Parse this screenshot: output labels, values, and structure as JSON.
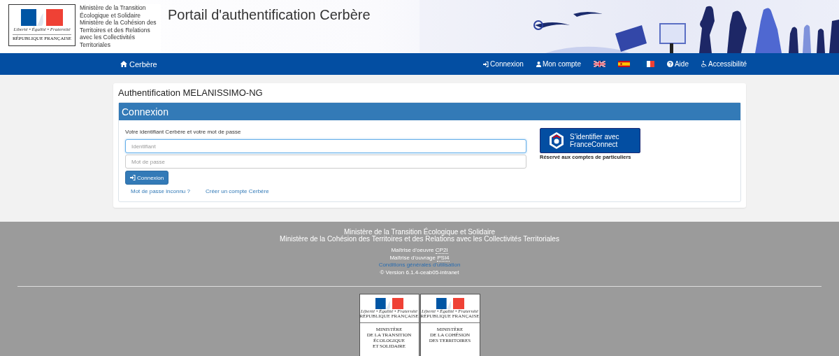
{
  "header": {
    "logo": {
      "motto": "Liberté • Égalité • Fraternité",
      "republic": "RÉPUBLIQUE FRANÇAISE"
    },
    "ministry_lines": [
      "Ministère de la Transition",
      "Écologique et Solidaire",
      "Ministère de la Cohésion des",
      "Territoires et des Relations",
      "avec les Collectivités",
      "Territoriales"
    ],
    "title": "Portail d'authentification Cerbère"
  },
  "navbar": {
    "brand": "Cerbère",
    "links_left": [
      {
        "label": "Connexion"
      },
      {
        "label": "Mon compte"
      }
    ],
    "flags": [
      {
        "kind": "uk"
      },
      {
        "kind": "spain"
      },
      {
        "kind": "france"
      }
    ],
    "links_right": [
      {
        "label": "Aide"
      },
      {
        "label": "Accessibilité"
      }
    ]
  },
  "page_title": "Authentification MELANISSIMO-NG",
  "panel": {
    "heading": "Connexion",
    "instruction": "Votre identifiant Cerbère et votre mot de passe",
    "fields": [
      {
        "placeholder": "Identifiant",
        "focused": true
      },
      {
        "placeholder": "Mot de passe",
        "focused": false
      }
    ],
    "submit": "Connexion",
    "links": [
      "Mot de passe inconnu ?",
      "Créer un compte Cerbère"
    ],
    "franceconnect": {
      "label_lines": [
        "S’identifier avec",
        "FranceConnect"
      ],
      "note": "Réservé aux comptes de particuliers"
    }
  },
  "footer": {
    "ministries": [
      "Ministère de la Transition Écologique et Solidaire",
      "Ministère de la Cohésion des Territoires et des Relations avec les Collectivités Territoriales"
    ],
    "credits": [
      {
        "label": "Maîtrise d'oeuvre",
        "abbr": "CP2I"
      },
      {
        "label": "Maîtrise d'ouvrage",
        "abbr": "PSI4"
      }
    ],
    "terms_link": "Conditions générales d'utilisation",
    "version": "© Version 6.1.4-ceab05-intranet",
    "logos": [
      {
        "motto": "Liberté • Égalité • Fraternité",
        "republic": "RÉPUBLIQUE FRANÇAISE",
        "ministry_lines": [
          "MINISTÈRE",
          "DE LA TRANSITION",
          "ÉCOLOGIQUE",
          "ET SOLIDAIRE"
        ]
      },
      {
        "motto": "Liberté • Égalité • Fraternité",
        "republic": "RÉPUBLIQUE FRANÇAISE",
        "ministry_lines": [
          "MINISTÈRE",
          "DE LA COHÉSION",
          "DES TERRITOIRES"
        ]
      }
    ]
  }
}
